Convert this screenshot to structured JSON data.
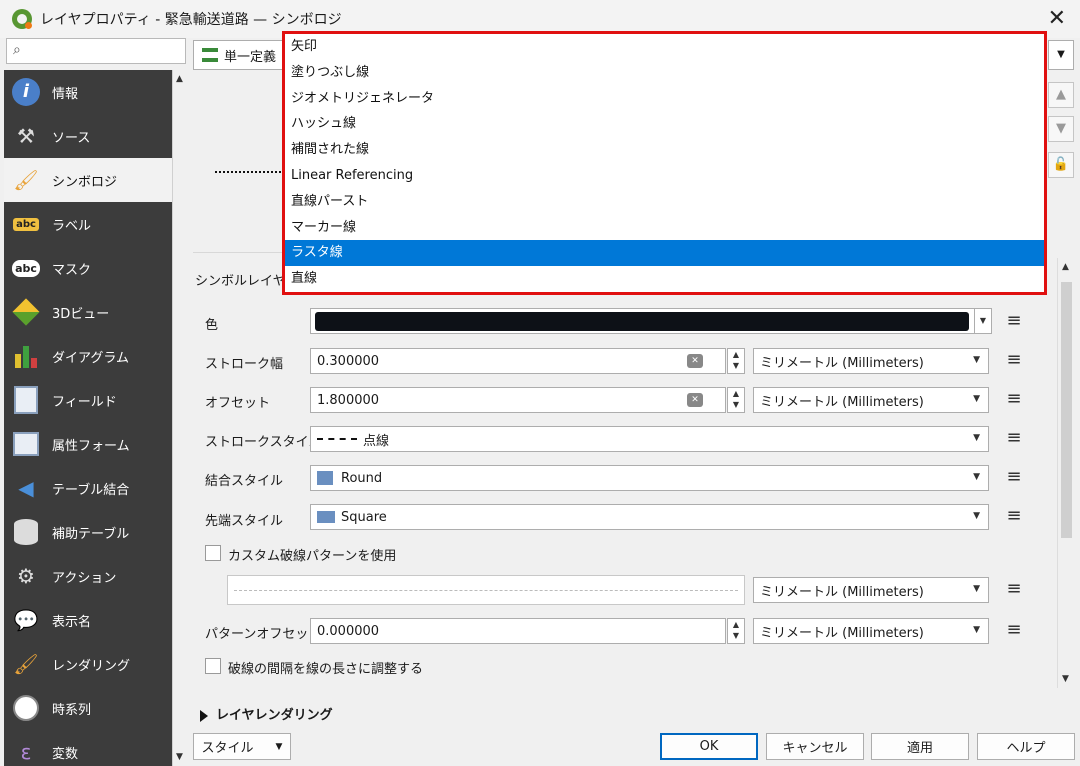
{
  "window": {
    "title": "レイヤプロパティ - 緊急輸送道路 — シンボロジ",
    "close": "✕"
  },
  "sidebar": {
    "search_placeholder": "",
    "items": [
      {
        "label": "情報",
        "icon": "info-icon",
        "active": false
      },
      {
        "label": "ソース",
        "icon": "source-icon",
        "active": false
      },
      {
        "label": "シンボロジ",
        "icon": "symbology-icon",
        "active": true
      },
      {
        "label": "ラベル",
        "icon": "labels-icon",
        "active": false
      },
      {
        "label": "マスク",
        "icon": "mask-icon",
        "active": false
      },
      {
        "label": "3Dビュー",
        "icon": "3d-view-icon",
        "active": false
      },
      {
        "label": "ダイアグラム",
        "icon": "diagram-icon",
        "active": false
      },
      {
        "label": "フィールド",
        "icon": "fields-icon",
        "active": false
      },
      {
        "label": "属性フォーム",
        "icon": "attribute-form-icon",
        "active": false
      },
      {
        "label": "テーブル結合",
        "icon": "joins-icon",
        "active": false
      },
      {
        "label": "補助テーブル",
        "icon": "auxiliary-storage-icon",
        "active": false
      },
      {
        "label": "アクション",
        "icon": "actions-icon",
        "active": false
      },
      {
        "label": "表示名",
        "icon": "display-icon",
        "active": false
      },
      {
        "label": "レンダリング",
        "icon": "rendering-icon",
        "active": false
      },
      {
        "label": "時系列",
        "icon": "temporal-icon",
        "active": false
      },
      {
        "label": "変数",
        "icon": "variables-icon",
        "active": false
      }
    ]
  },
  "renderer": {
    "label": "単一定義"
  },
  "symbol_layer_type_label": "シンボルレイヤ型",
  "dropdown": {
    "items": [
      "矢印",
      "塗りつぶし線",
      "ジオメトリジェネレータ",
      "ハッシュ線",
      "補間された線",
      "Linear Referencing",
      "直線パースト",
      "マーカー線",
      "ラスタ線",
      "直線"
    ],
    "selected_index": 8
  },
  "form": {
    "color_label": "色",
    "color_value": "#0d1117",
    "stroke_width_label": "ストローク幅",
    "stroke_width_value": "0.300000",
    "offset_label": "オフセット",
    "offset_value": "1.800000",
    "stroke_style_label": "ストロークスタイル",
    "stroke_style_value": "点線",
    "join_style_label": "結合スタイル",
    "join_style_value": "Round",
    "cap_style_label": "先端スタイル",
    "cap_style_value": "Square",
    "custom_dash_label": "カスタム破線パターンを使用",
    "pattern_offset_label": "パターンオフセット",
    "pattern_offset_value": "0.000000",
    "adjust_dash_label": "破線の間隔を線の長さに調整する",
    "unit": "ミリメートル (Millimeters)"
  },
  "layer_rendering": "レイヤレンダリング",
  "buttons": {
    "style": "スタイル",
    "ok": "OK",
    "cancel": "キャンセル",
    "apply": "適用",
    "help": "ヘルプ"
  }
}
